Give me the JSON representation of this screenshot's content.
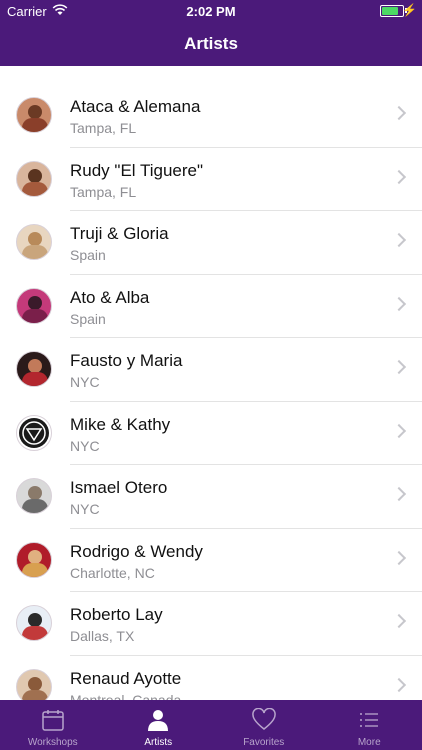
{
  "status": {
    "carrier": "Carrier",
    "time": "2:02 PM"
  },
  "nav": {
    "title": "Artists"
  },
  "artists": [
    {
      "name": "Ataca & Alemana",
      "location": "Tampa, FL"
    },
    {
      "name": "Rudy \"El Tiguere\"",
      "location": "Tampa, FL"
    },
    {
      "name": "Truji & Gloria",
      "location": "Spain"
    },
    {
      "name": "Ato & Alba",
      "location": "Spain"
    },
    {
      "name": "Fausto y Maria",
      "location": "NYC"
    },
    {
      "name": "Mike & Kathy",
      "location": "NYC"
    },
    {
      "name": "Ismael Otero",
      "location": "NYC"
    },
    {
      "name": "Rodrigo & Wendy",
      "location": "Charlotte, NC"
    },
    {
      "name": "Roberto Lay",
      "location": "Dallas, TX"
    },
    {
      "name": "Renaud Ayotte",
      "location": "Montreal, Canada"
    }
  ],
  "tabs": [
    {
      "label": "Workshops",
      "icon": "calendar-icon"
    },
    {
      "label": "Artists",
      "icon": "person-icon"
    },
    {
      "label": "Favorites",
      "icon": "heart-icon"
    },
    {
      "label": "More",
      "icon": "list-icon"
    }
  ],
  "colors": {
    "brand": "#4b1a7a",
    "tab_active": "#ffffff",
    "tab_inactive": "#b8a4cc"
  }
}
